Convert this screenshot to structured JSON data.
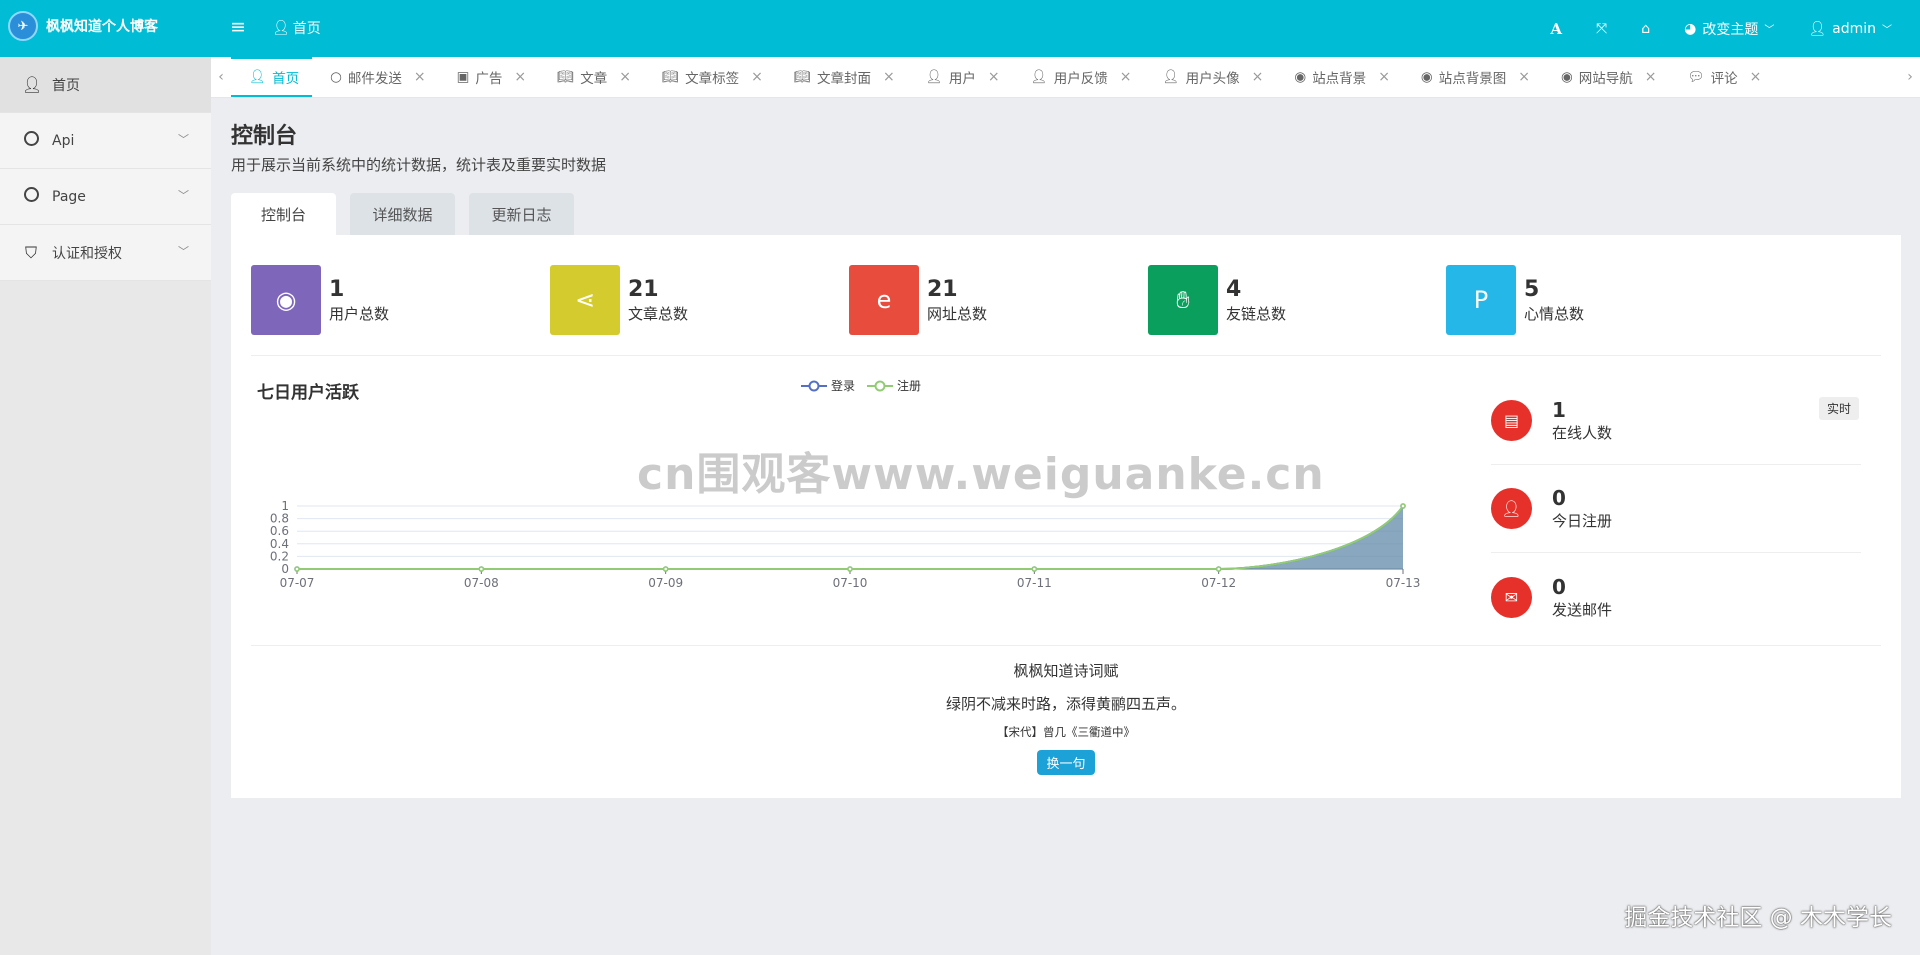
{
  "header": {
    "brand": "枫枫知道个人博客",
    "home_label": "首页",
    "theme_label": "改变主题",
    "user_label": "admin"
  },
  "sidebar": {
    "items": [
      {
        "label": "首页",
        "icon": "user-icon"
      },
      {
        "label": "Api",
        "icon": "circle-icon"
      },
      {
        "label": "Page",
        "icon": "circle-icon"
      },
      {
        "label": "认证和授权",
        "icon": "shield-icon"
      }
    ]
  },
  "tabs": [
    {
      "label": "首页",
      "icon": "user-icon"
    },
    {
      "label": "邮件发送",
      "icon": "circle-icon"
    },
    {
      "label": "广告",
      "icon": "image-icon"
    },
    {
      "label": "文章",
      "icon": "book-icon"
    },
    {
      "label": "文章标签",
      "icon": "book-icon"
    },
    {
      "label": "文章封面",
      "icon": "book-icon"
    },
    {
      "label": "用户",
      "icon": "user-icon"
    },
    {
      "label": "用户反馈",
      "icon": "user-icon"
    },
    {
      "label": "用户头像",
      "icon": "user-icon"
    },
    {
      "label": "站点背景",
      "icon": "globe-icon"
    },
    {
      "label": "站点背景图",
      "icon": "globe-icon"
    },
    {
      "label": "网站导航",
      "icon": "globe-icon"
    },
    {
      "label": "评论",
      "icon": "comment-icon"
    }
  ],
  "page": {
    "title": "控制台",
    "subtitle": "用于展示当前系统中的统计数据，统计表及重要实时数据",
    "subtabs": [
      "控制台",
      "详细数据",
      "更新日志"
    ]
  },
  "stats": [
    {
      "value": "1",
      "label": "用户总数",
      "color": "#7e67ba",
      "icon": "user-circle-icon"
    },
    {
      "value": "21",
      "label": "文章总数",
      "color": "#d4cc2e",
      "icon": "share-icon"
    },
    {
      "value": "21",
      "label": "网址总数",
      "color": "#e84c3d",
      "icon": "ie-icon"
    },
    {
      "value": "4",
      "label": "友链总数",
      "color": "#0a9f5c",
      "icon": "handshake-icon"
    },
    {
      "value": "5",
      "label": "心情总数",
      "color": "#25b7e8",
      "icon": "pinterest-icon"
    }
  ],
  "chart_data": {
    "type": "area",
    "title": "七日用户活跃",
    "categories": [
      "07-07",
      "07-08",
      "07-09",
      "07-10",
      "07-11",
      "07-12",
      "07-13"
    ],
    "series": [
      {
        "name": "登录",
        "values": [
          0,
          0,
          0,
          0,
          0,
          0,
          1
        ],
        "color": "#5470c6"
      },
      {
        "name": "注册",
        "values": [
          0,
          0,
          0,
          0,
          0,
          0,
          1
        ],
        "color": "#91cc75"
      }
    ],
    "yticks": [
      "0",
      "0.2",
      "0.4",
      "0.6",
      "0.8",
      "1"
    ],
    "ylim": [
      0,
      1
    ],
    "grid": true,
    "legend": "top-center"
  },
  "right_stats": [
    {
      "value": "1",
      "label": "在线人数",
      "badge": "实时",
      "icon": "id-card-icon"
    },
    {
      "value": "0",
      "label": "今日注册",
      "icon": "user-icon"
    },
    {
      "value": "0",
      "label": "发送邮件",
      "icon": "envelope-icon"
    }
  ],
  "poem": {
    "title": "枫枫知道诗词赋",
    "line": "绿阴不减来时路，添得黄鹂四五声。",
    "source": "【宋代】曾几《三衢道中》",
    "button": "换一句"
  },
  "watermark": "cn围观客www.weiguanke.cn",
  "credit": "掘金技术社区 @ 木木学长"
}
